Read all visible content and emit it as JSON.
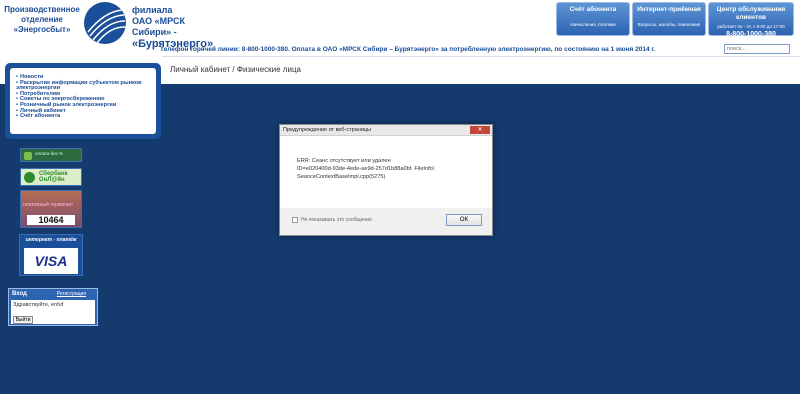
{
  "header": {
    "brand_left": [
      "Производственное",
      "отделение",
      "«Энергосбыт»"
    ],
    "brand_right": [
      "филиала",
      "ОАО «МРСК Сибири» -"
    ],
    "brand_right_big": "«Бурятэнерго»",
    "hotline": "Телефон горячей линии: 8-800-1000-380. Оплата в ОАО «МРСК Сибири – Бурятэнерго» за потребленную электроэнергию, по состоянию на 1 июня 2014 г.",
    "search_placeholder": "поиск...",
    "buttons": [
      {
        "title": "Счёт абонента",
        "sub": "Начисления, платежи"
      },
      {
        "title": "Интернет-приёмная",
        "sub": "Вопросы, жалобы, пожелания"
      },
      {
        "title": "Центр обслуживания клиентов",
        "sub": "работает пн - пт, с 8-00 до 17-00",
        "phone": "8-800-1000-380"
      }
    ]
  },
  "breadcrumb": "Личный кабинет / Физические лица",
  "sidebar": {
    "menu": [
      "Новости",
      "Раскрытие информации субъектом рынков электроэнергии",
      "Потребителям",
      "Советы по энергосбережению",
      "Розничный рынок электроэнергии",
      "Личный кабинет",
      "Счёт абонента"
    ],
    "banners": {
      "b1": "оплата без %",
      "b2_line1": "Сбербанк",
      "b2_line2": "ОнЛ@йн",
      "b3_text": "платежный терминал",
      "b3_number": "10464",
      "b4_text": "интернет - платёж",
      "b4_logo": "VISA"
    },
    "login": {
      "title": "Вход",
      "register": "Регистрация",
      "greeting": "Здравствуйте, enfuf",
      "logout": "Выйти"
    }
  },
  "dialog": {
    "title": "Предупреждение от веб-страницы",
    "close": "✕",
    "message_lines": [
      "ERR: Сеанс отсутствует или удален",
      "ID=e020400d-93de-4ede-ae9d-257d1b88a0bf. FileInfo\\",
      "SeanceContextBaseImpl.cpp(5275)"
    ],
    "checkbox_label": "Не показывать это сообщение.",
    "ok": "ОК"
  }
}
